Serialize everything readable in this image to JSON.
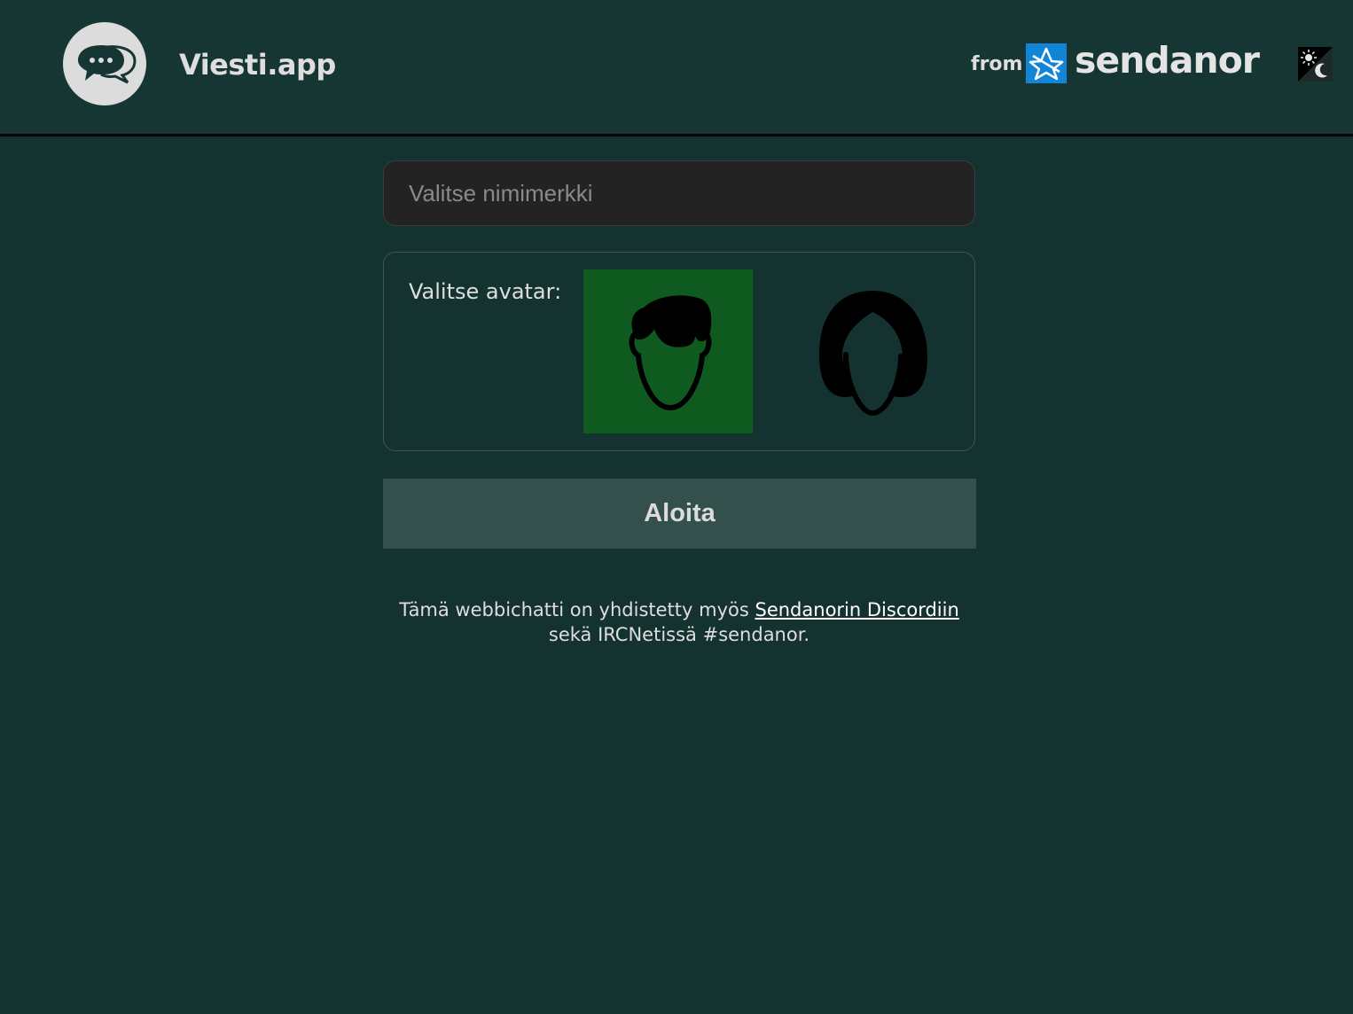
{
  "header": {
    "app_title": "Viesti.app",
    "from_label": "from",
    "brand_name": "sendanor",
    "logo_icon": "chat-bubbles-icon",
    "theme_toggle_icon": "sun-moon-icon"
  },
  "form": {
    "nickname_placeholder": "Valitse nimimerkki",
    "nickname_value": "",
    "avatar_label": "Valitse avatar:",
    "avatars": [
      {
        "name": "male",
        "icon": "male-avatar-icon",
        "selected": true
      },
      {
        "name": "female",
        "icon": "female-avatar-icon",
        "selected": false
      }
    ],
    "start_label": "Aloita"
  },
  "info": {
    "line1_prefix": "Tämä webbichatti on yhdistetty myös",
    "discord_link": "Sendanorin Discordiin",
    "line2": "sekä IRCNetissä #sendanor."
  },
  "colors": {
    "background": "#143330",
    "selected_avatar": "#0e5a1f",
    "button": "#33504c",
    "brand_blue": "#1286d6"
  }
}
